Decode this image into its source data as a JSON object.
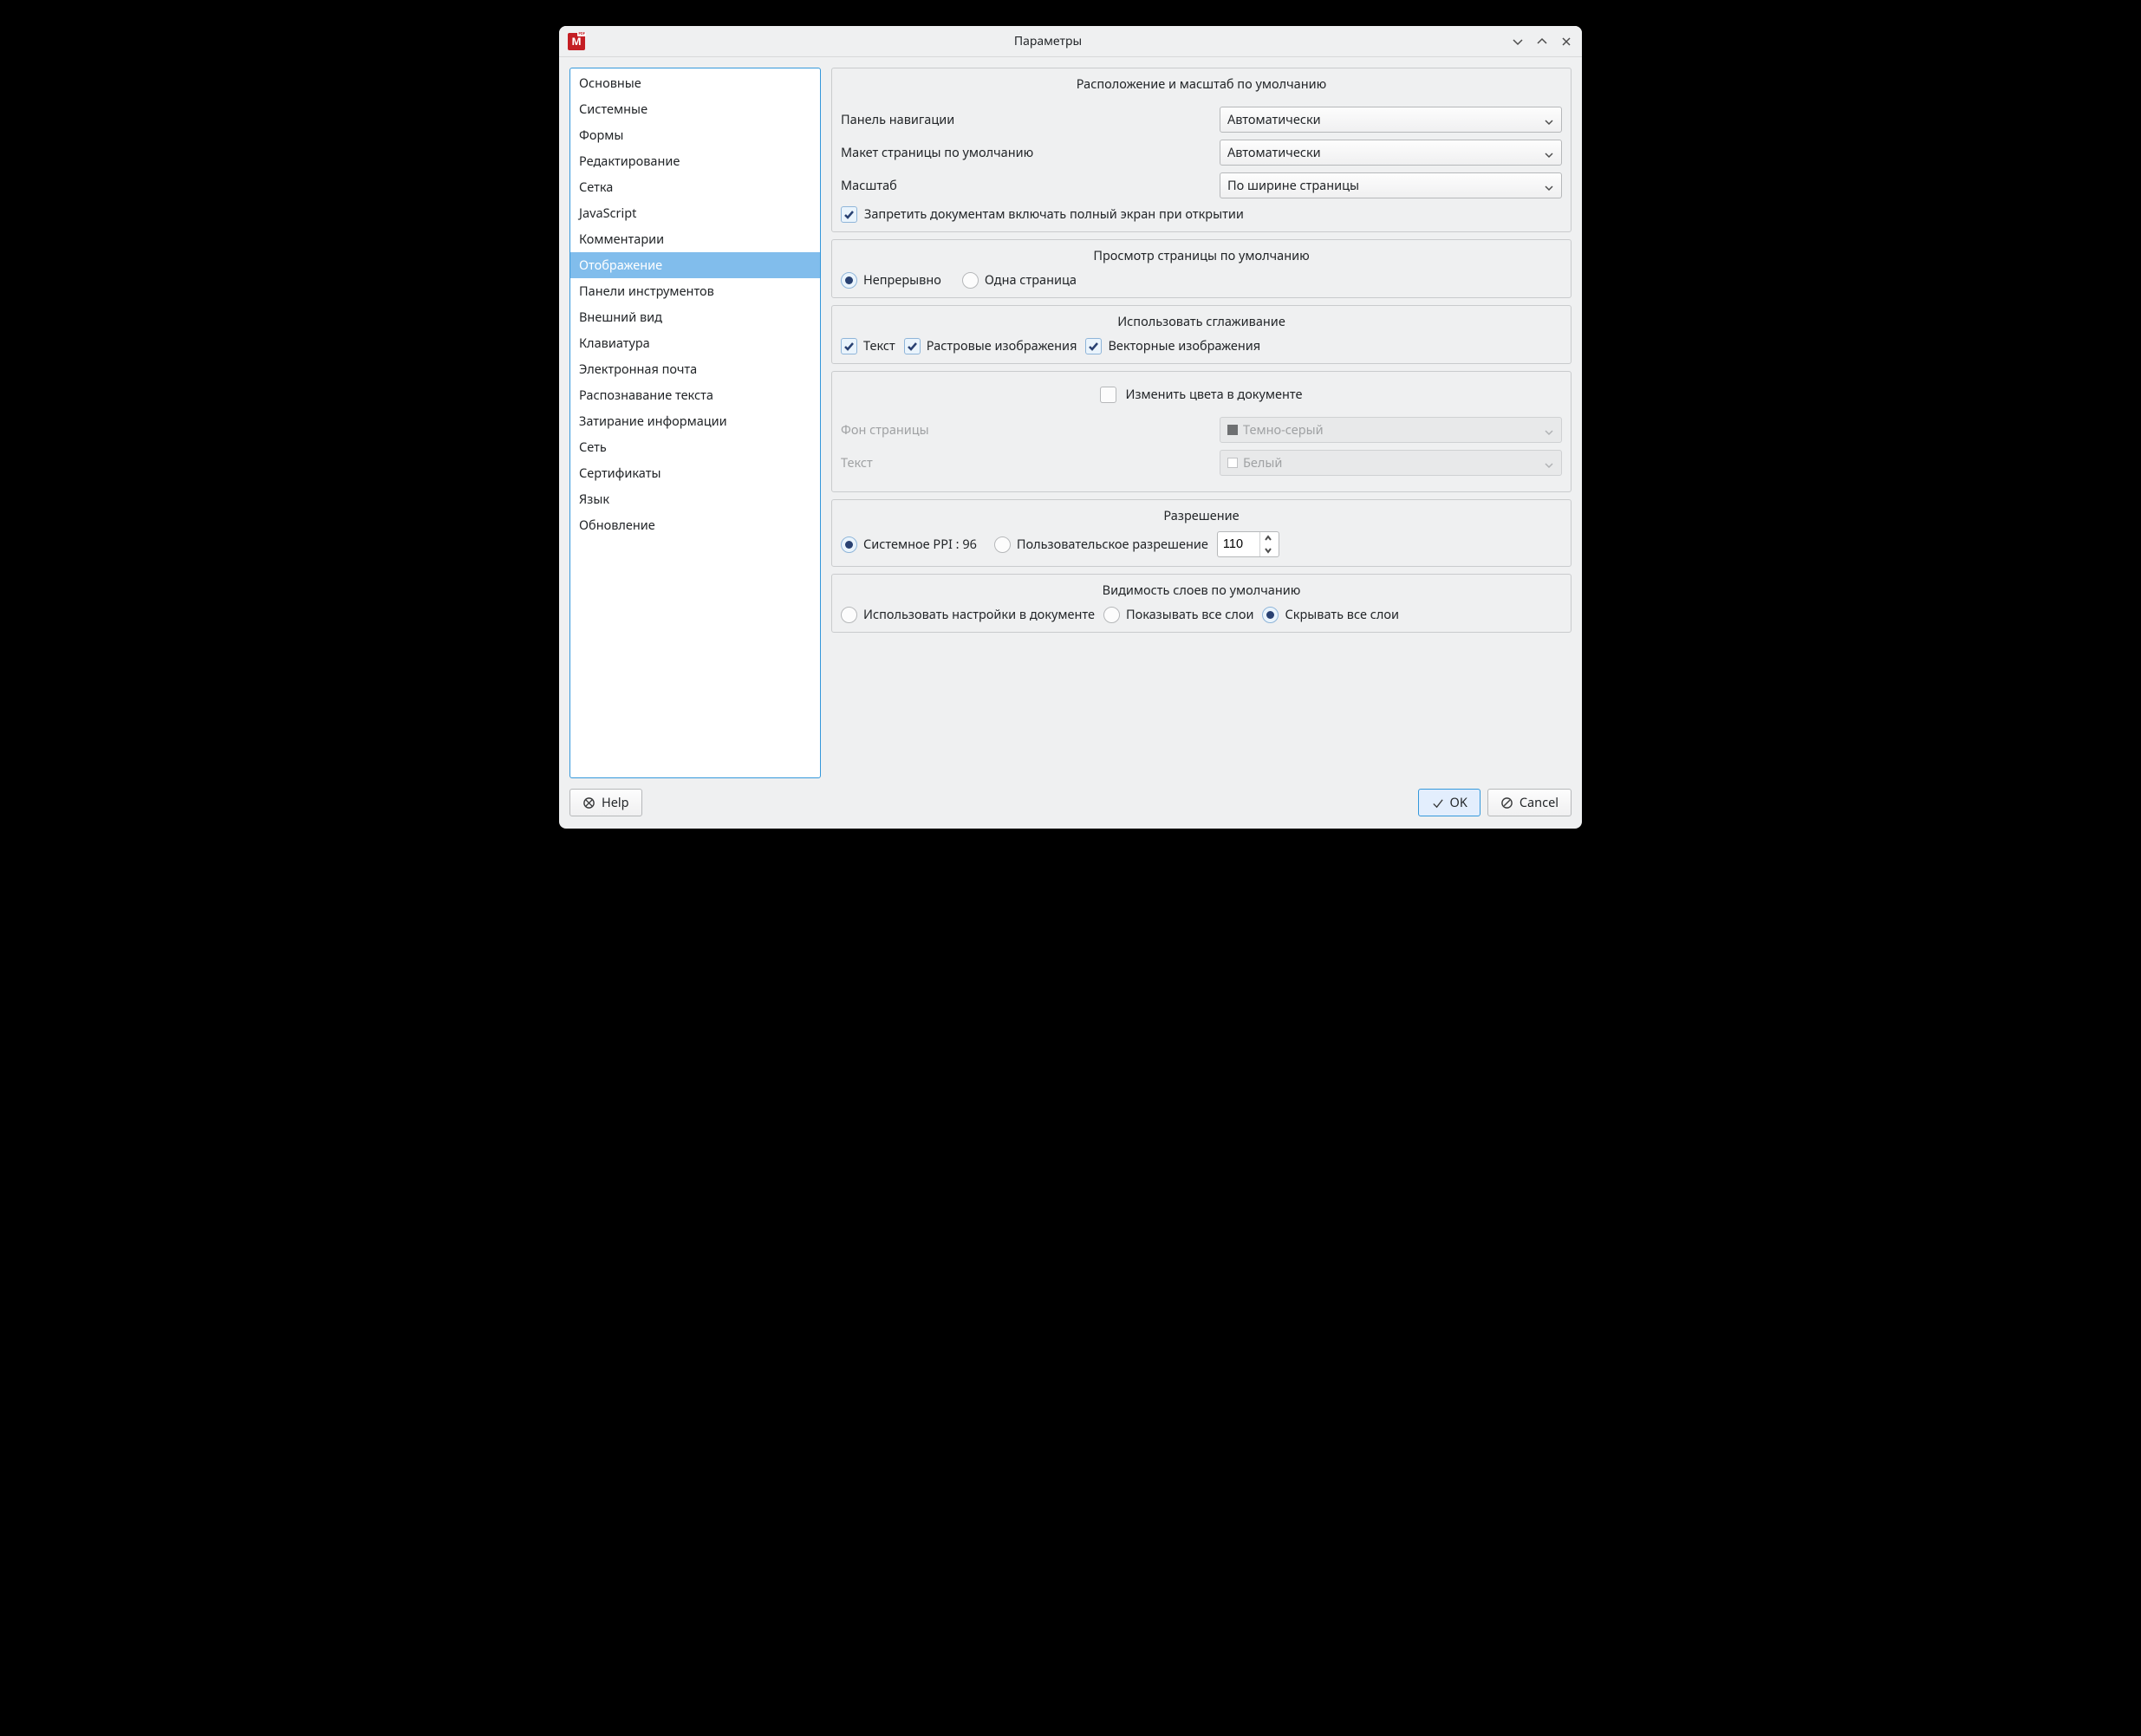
{
  "window": {
    "title": "Параметры"
  },
  "sidebar": {
    "items": [
      "Основные",
      "Системные",
      "Формы",
      "Редактирование",
      "Сетка",
      "JavaScript",
      "Комментарии",
      "Отображение",
      "Панели инструментов",
      "Внешний вид",
      "Клавиатура",
      "Электронная почта",
      "Распознавание текста",
      "Затирание информации",
      "Сеть",
      "Сертификаты",
      "Язык",
      "Обновление"
    ],
    "selectedIndex": 7
  },
  "groups": {
    "layout": {
      "title": "Расположение и масштаб по умолчанию",
      "navPanelLabel": "Панель навигации",
      "navPanelValue": "Автоматически",
      "pageLayoutLabel": "Макет страницы по умолчанию",
      "pageLayoutValue": "Автоматически",
      "zoomLabel": "Масштаб",
      "zoomValue": "По ширине страницы",
      "disableFullscreenLabel": "Запретить документам включать полный экран при открытии"
    },
    "pageView": {
      "title": "Просмотр страницы по умолчанию",
      "continuousLabel": "Непрерывно",
      "singleLabel": "Одна страница"
    },
    "smoothing": {
      "title": "Использовать сглаживание",
      "textLabel": "Текст",
      "rasterLabel": "Растровые изображения",
      "vectorLabel": "Векторные изображения"
    },
    "colors": {
      "changeColorsLabel": "Изменить цвета в документе",
      "bgLabel": "Фон страницы",
      "bgValue": "Темно-серый",
      "textLabel": "Текст",
      "textValue": "Белый"
    },
    "resolution": {
      "title": "Разрешение",
      "systemPpiLabel": "Системное PPI : 96",
      "customLabel": "Пользовательское разрешение",
      "customValue": "110"
    },
    "layers": {
      "title": "Видимость слоев по умолчанию",
      "useDocLabel": "Использовать настройки в документе",
      "showAllLabel": "Показывать все слои",
      "hideAllLabel": "Скрывать все слои"
    }
  },
  "footer": {
    "helpLabel": "Help",
    "okLabel": "OK",
    "cancelLabel": "Cancel"
  }
}
